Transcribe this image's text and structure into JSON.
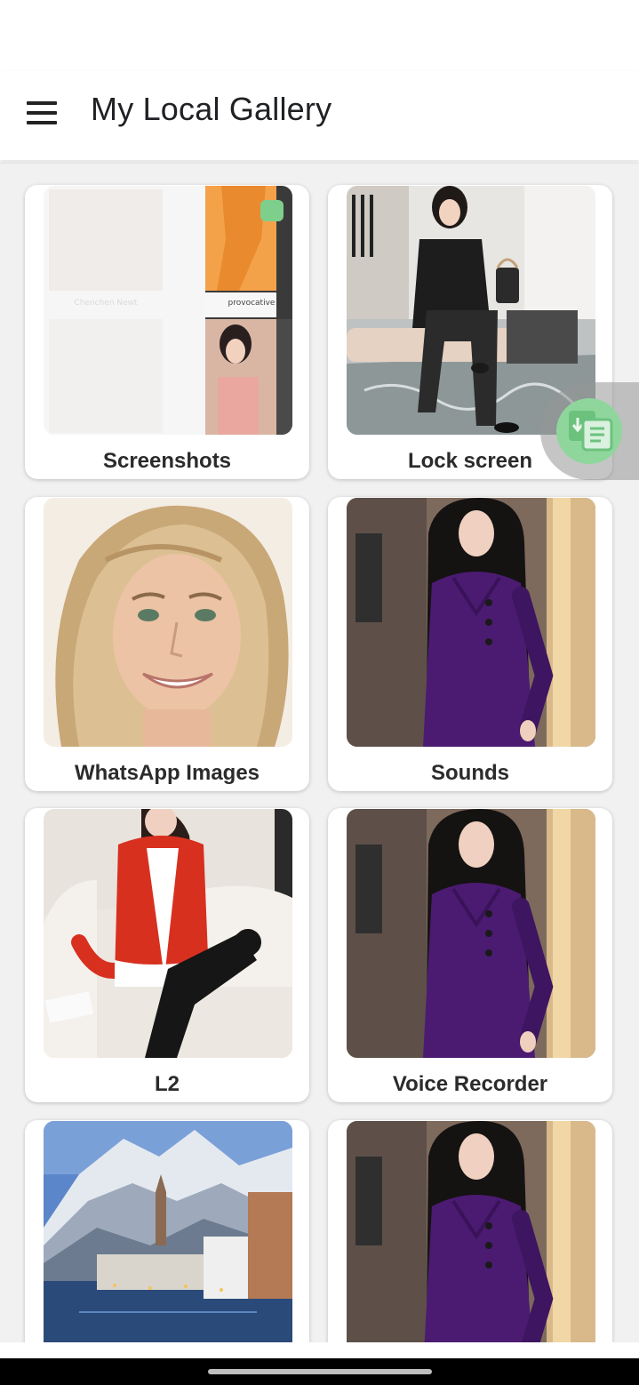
{
  "app_bar": {
    "title": "My Local Gallery",
    "menu_icon": "hamburger-menu-icon"
  },
  "albums": [
    {
      "label": "Screenshots"
    },
    {
      "label": "Lock screen"
    },
    {
      "label": "WhatsApp Images"
    },
    {
      "label": "Sounds"
    },
    {
      "label": "L2"
    },
    {
      "label": "Voice Recorder"
    },
    {
      "label": ""
    },
    {
      "label": ""
    }
  ],
  "floating_button": {
    "icon": "translate-icon"
  },
  "screenshot_preview": {
    "caption_left": "Chenchen Newt",
    "caption_right": "provocative"
  }
}
